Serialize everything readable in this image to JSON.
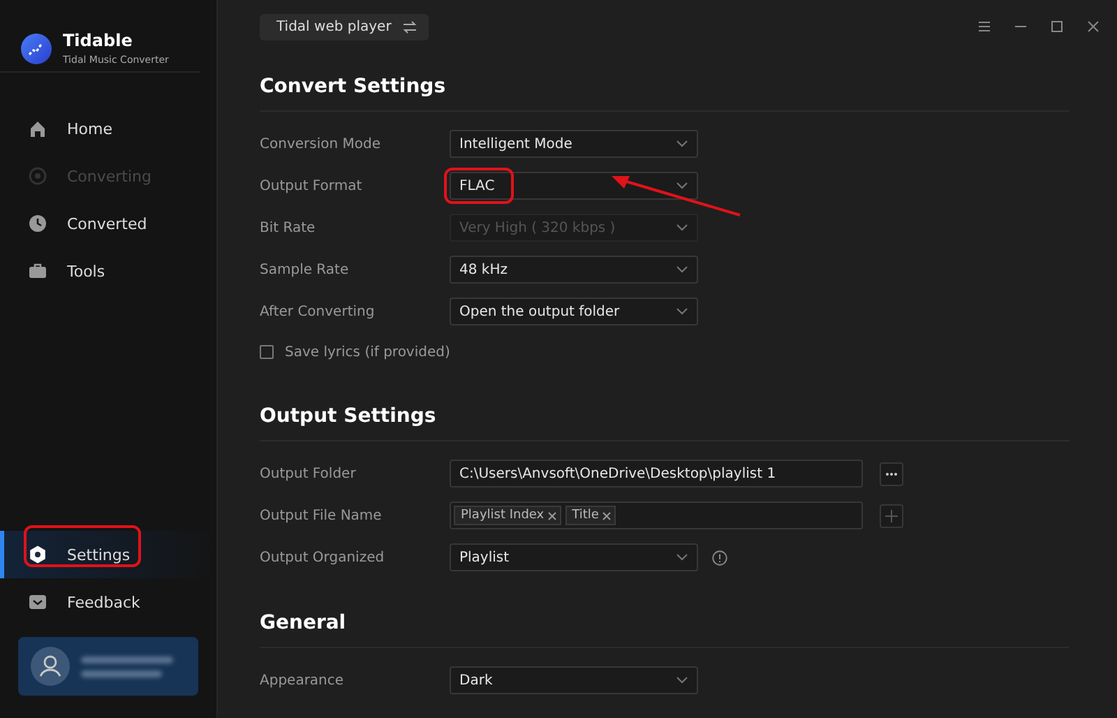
{
  "app": {
    "name": "Tidable",
    "subtitle": "Tidal Music Converter"
  },
  "nav": [
    {
      "label": "Home",
      "disabled": false,
      "selected": false,
      "highlighted": false
    },
    {
      "label": "Converting",
      "disabled": true,
      "selected": false,
      "highlighted": false
    },
    {
      "label": "Converted",
      "disabled": false,
      "selected": false,
      "highlighted": false
    },
    {
      "label": "Tools",
      "disabled": false,
      "selected": false,
      "highlighted": false
    }
  ],
  "nav_bottom": [
    {
      "label": "Settings",
      "disabled": false,
      "selected": true,
      "highlighted": true
    },
    {
      "label": "Feedback",
      "disabled": false,
      "selected": false,
      "highlighted": false
    }
  ],
  "source_button": {
    "label": "Tidal web player"
  },
  "sections": [
    {
      "title": "Convert Settings",
      "rows": [
        {
          "kind": "select",
          "label": "Conversion Mode",
          "value": "Intelligent Mode",
          "disabled": false,
          "highlighted": false,
          "arrow": false
        },
        {
          "kind": "select",
          "label": "Output Format",
          "value": "FLAC",
          "disabled": false,
          "highlighted": true,
          "arrow": true
        },
        {
          "kind": "select",
          "label": "Bit Rate",
          "value": "Very High ( 320 kbps )",
          "disabled": true,
          "highlighted": false,
          "arrow": false
        },
        {
          "kind": "select",
          "label": "Sample Rate",
          "value": "48 kHz",
          "disabled": false,
          "highlighted": false,
          "arrow": false
        },
        {
          "kind": "select",
          "label": "After Converting",
          "value": "Open the output folder",
          "disabled": false,
          "highlighted": false,
          "arrow": false
        },
        {
          "kind": "checkbox",
          "label": "Save lyrics (if provided)",
          "checked": false
        }
      ]
    },
    {
      "title": "Output Settings",
      "rows": [
        {
          "kind": "path",
          "label": "Output Folder",
          "value": "C:\\Users\\Anvsoft\\OneDrive\\Desktop\\playlist 1"
        },
        {
          "kind": "tags",
          "label": "Output File Name",
          "tags": [
            "Playlist Index",
            "Title"
          ]
        },
        {
          "kind": "select-info",
          "label": "Output Organized",
          "value": "Playlist",
          "disabled": false,
          "highlighted": false,
          "arrow": false
        }
      ]
    },
    {
      "title": "General",
      "rows": [
        {
          "kind": "select",
          "label": "Appearance",
          "value": "Dark",
          "disabled": false,
          "highlighted": false,
          "arrow": false
        }
      ]
    }
  ]
}
